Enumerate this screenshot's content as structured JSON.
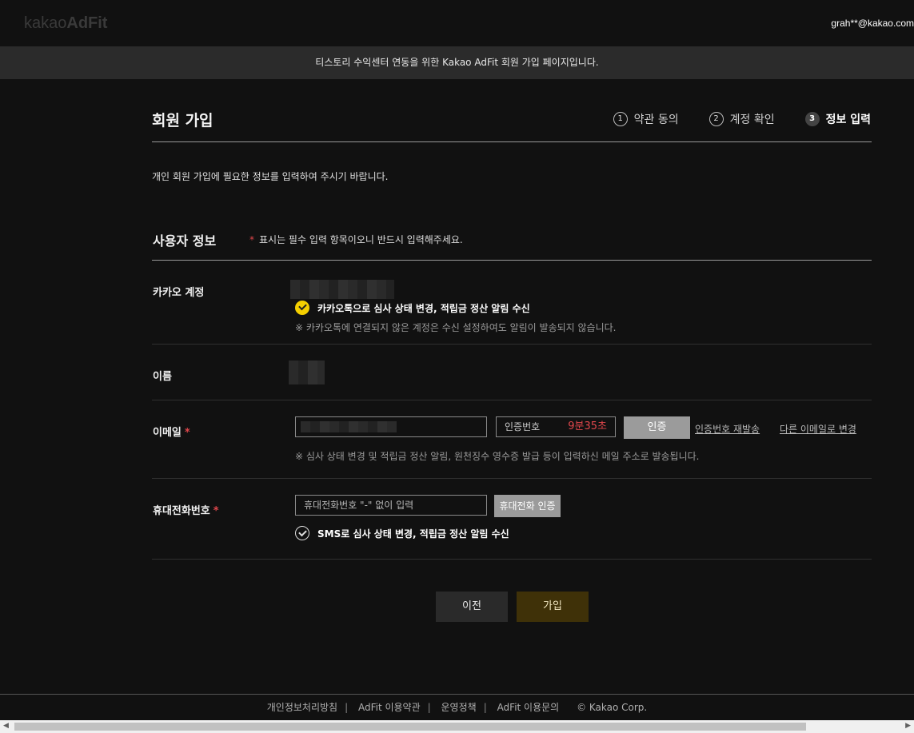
{
  "header": {
    "logo_part1": "kakao",
    "logo_part2": "AdFit",
    "user_email": "grah**@kakao.com"
  },
  "notice": "티스토리 수익센터 연동을 위한 Kakao AdFit 회원 가입 페이지입니다.",
  "page": {
    "title": "회원 가입",
    "intro": "개인 회원 가입에 필요한 정보를 입력하여 주시기 바랍니다.",
    "steps": [
      {
        "num": "1",
        "label": "약관 동의"
      },
      {
        "num": "2",
        "label": "계정 확인"
      },
      {
        "num": "3",
        "label": "정보 입력"
      }
    ]
  },
  "section": {
    "title": "사용자 정보",
    "note_asterisk": "*",
    "note": "표시는 필수 입력 항목이오니 반드시 입력해주세요."
  },
  "kakao_account": {
    "label": "카카오 계정",
    "kakaotalk_check": "카카오톡으로 심사 상태 변경, 적립금 정산 알림 수신",
    "hint": "※ 카카오톡에 연결되지 않은 계정은 수신 설정하여도 알림이 발송되지 않습니다."
  },
  "name": {
    "label": "이름"
  },
  "email": {
    "label": "이메일",
    "required": "*",
    "code_placeholder": "인증번호",
    "timer": "9분35초",
    "verify_button": "인증",
    "resend_link": "인증번호 재발송",
    "change_link": "다른 이메일로 변경",
    "hint": "※ 심사 상태 변경 및 적립금 정산 알림, 원천징수 영수증 발급 등이 입력하신 메일 주소로 발송됩니다."
  },
  "phone": {
    "label": "휴대전화번호",
    "required": "*",
    "placeholder": "휴대전화번호 \"-\" 없이 입력",
    "verify_button": "휴대전화 인증",
    "sms_check": "SMS로 심사 상태 변경, 적립금 정산 알림 수신"
  },
  "actions": {
    "prev": "이전",
    "join": "가입"
  },
  "footer": {
    "links": [
      "개인정보처리방침",
      "AdFit 이용약관",
      "운영정책",
      "AdFit 이용문의"
    ],
    "copyright": "© Kakao Corp."
  },
  "colors": {
    "background": "#111111",
    "accent_yellow": "#f4cf00",
    "required_red": "#e0474c",
    "join_button": "#3f3108"
  }
}
